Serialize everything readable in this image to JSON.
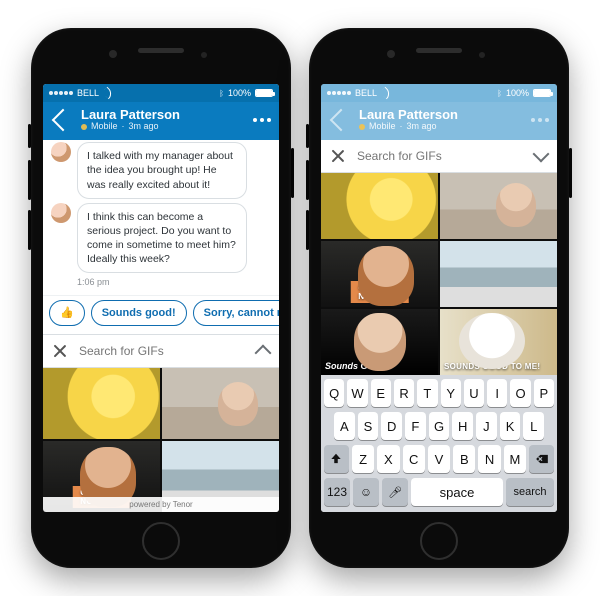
{
  "status_bar": {
    "carrier": "BELL",
    "battery_pct": "100%"
  },
  "conversation": {
    "contact_name": "Laura Patterson",
    "presence": "Mobile",
    "time_ago": "3m ago"
  },
  "messages": [
    {
      "text": "I talked with my manager about the idea you brought up! He was really excited about it!"
    },
    {
      "text": "I think this can become a serious project. Do you want to come in sometime to meet him? Ideally this week?"
    }
  ],
  "timestamp": "1:06 pm",
  "quick_replies": {
    "emoji": "👍",
    "reply1": "Sounds good!",
    "reply2": "Sorry, cannot make it"
  },
  "gif_search": {
    "placeholder": "Search for GIFs",
    "powered_by": "powered by Tenor"
  },
  "gif_tiles": {
    "chuck_caption": "CHUCK NORRIS",
    "ferrell_caption": "Sounds Good.",
    "cat_caption": "SOUNDS GOOD TO ME!"
  },
  "keyboard": {
    "row1": [
      "Q",
      "W",
      "E",
      "R",
      "T",
      "Y",
      "U",
      "I",
      "O",
      "P"
    ],
    "row2": [
      "A",
      "S",
      "D",
      "F",
      "G",
      "H",
      "J",
      "K",
      "L"
    ],
    "row3": [
      "Z",
      "X",
      "C",
      "V",
      "B",
      "N",
      "M"
    ],
    "numbers_key": "123",
    "space_key": "space",
    "action_key": "search"
  }
}
